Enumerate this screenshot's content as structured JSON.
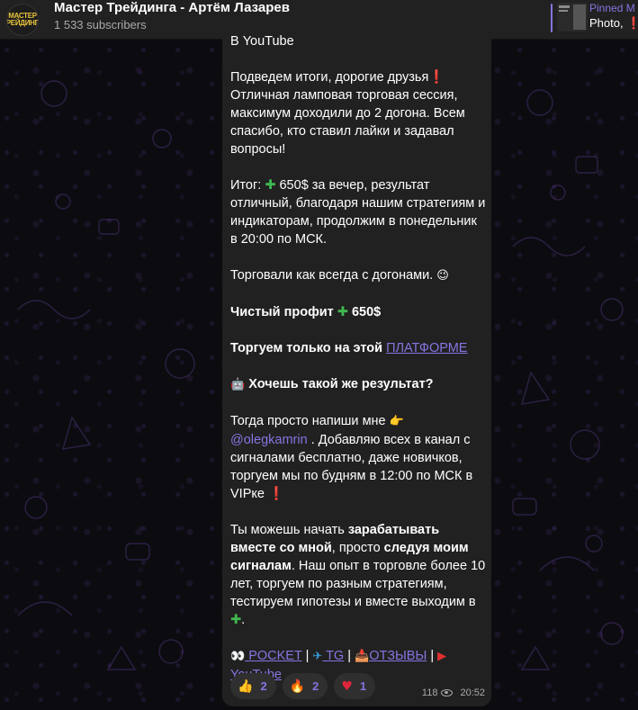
{
  "channel": {
    "title": "Мастер Трейдинга - Артём Лазарев",
    "subscribers": "1 533 subscribers",
    "avatar_text": "МАСТЕР ТРЕЙДИНГА"
  },
  "pinned": {
    "title": "Pinned M",
    "text": "Photo, ",
    "accent": "#8774e1"
  },
  "message": {
    "youtube_line": "В YouTube",
    "p1": "Подведем итоги, дорогие друзья",
    "p1b": "Отличная ламповая торговая сессия, максимум доходили до 2 догона. Всем спасибо, кто ставил лайки и задавал вопросы!",
    "p2a": "Итог: ",
    "p2b": " 650$ за вечер, результат отличный, благодаря нашим стратегиям и индикаторам, продолжим в понедельник в 20:00 по МСК.",
    "p3": "Торговали как всегда с догонами.",
    "p4a": "Чистый профит ",
    "p4b": " 650$",
    "p5a": "Торгуем только на этой ",
    "p5link": "ПЛАТФОРМЕ",
    "p6": " Хочешь такой же результат?",
    "p7a": "Тогда просто напиши мне",
    "p7mention": "@olegkamrin",
    "p7b": " . Добавляю всех в канал с сигналами бесплатно, даже новичков, торгуем мы по будням в 12:00 по МСК в VIPке ",
    "p8a": "Ты можешь начать ",
    "p8b": "зарабатывать вместе со мной",
    "p8c": ", просто ",
    "p8d": "следуя моим сигналам",
    "p8e": ". Наш опыт в торговле более 10 лет, торгуем по разным стратегиям, тестируем гипотезы и вместе выходим в ",
    "links": {
      "pocket": " POCKET",
      "tg": " TG",
      "reviews": "ОТЗЫВЫ",
      "youtube": "YouTube",
      "sep": " | "
    }
  },
  "reactions": [
    {
      "icon": "👍",
      "count": "2"
    },
    {
      "icon": "🔥",
      "count": "2"
    },
    {
      "icon": "♥",
      "count": "1"
    }
  ],
  "meta": {
    "views": "118",
    "time": "20:52"
  }
}
